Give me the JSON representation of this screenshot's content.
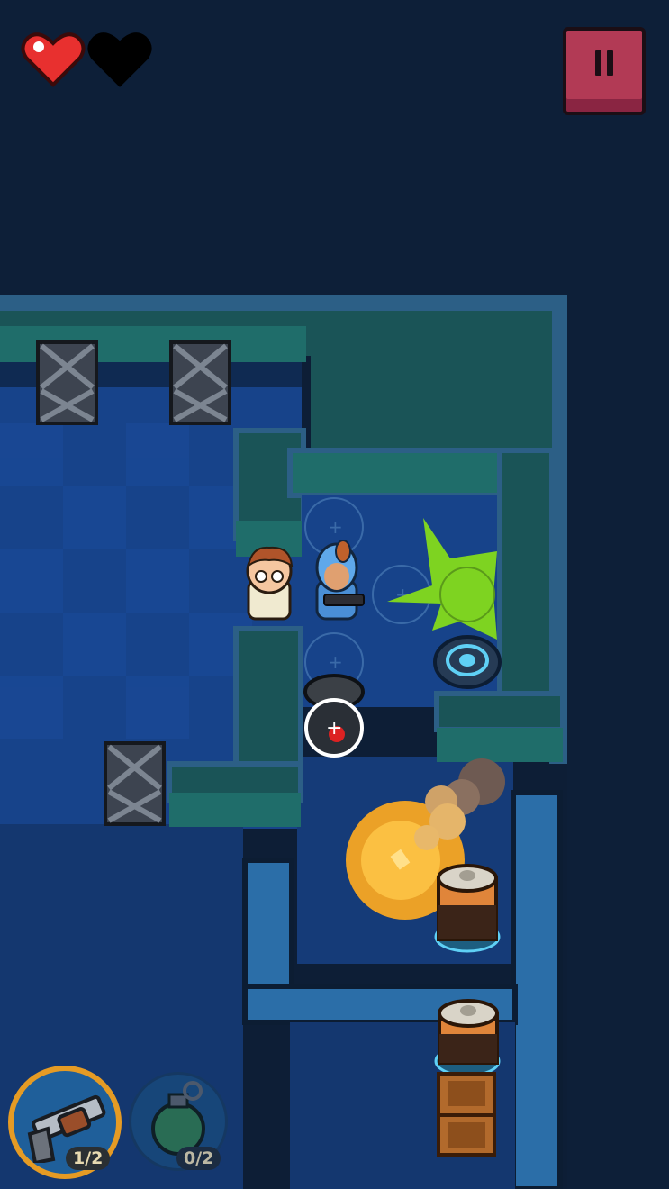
{
  "hud": {
    "hearts": [
      {
        "state": "full",
        "color": "#e8302f"
      },
      {
        "state": "empty",
        "color": "#000000"
      }
    ],
    "pause_icon": "pause-icon",
    "pause_color": "#b23a55"
  },
  "loadout": {
    "primary": {
      "icon": "revolver-icon",
      "ammo": "1/2",
      "ring_color": "#e59b24",
      "selected": true
    },
    "secondary": {
      "icon": "grenade-icon",
      "ammo": "0/2",
      "selected": false
    }
  },
  "colors": {
    "background": "#0d1e36",
    "floor": "#17438a",
    "wall_top": "#1f6d6a",
    "water": "#2b6ea8",
    "slime": "#7ed321",
    "explosion": "#f7a623"
  }
}
